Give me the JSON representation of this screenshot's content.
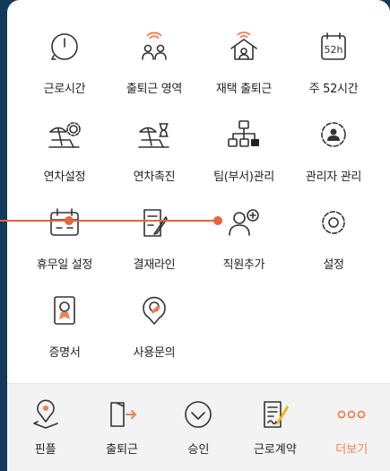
{
  "menu": [
    {
      "label": "근로시간",
      "icon": "clock-icon"
    },
    {
      "label": "출퇴근 영역",
      "icon": "location-area-icon"
    },
    {
      "label": "재택 출퇴근",
      "icon": "home-work-icon"
    },
    {
      "label": "주 52시간",
      "icon": "calendar-52h-icon"
    },
    {
      "label": "연차설정",
      "icon": "beach-gear-icon"
    },
    {
      "label": "연차촉진",
      "icon": "beach-hourglass-icon"
    },
    {
      "label": "팀(부서)관리",
      "icon": "org-chart-icon"
    },
    {
      "label": "관리자 관리",
      "icon": "admin-gear-icon"
    },
    {
      "label": "휴무일 설정",
      "icon": "calendar-holiday-icon"
    },
    {
      "label": "결재라인",
      "icon": "approval-doc-icon"
    },
    {
      "label": "직원추가",
      "icon": "add-user-icon"
    },
    {
      "label": "설정",
      "icon": "gear-icon"
    },
    {
      "label": "증명서",
      "icon": "certificate-icon"
    },
    {
      "label": "사용문의",
      "icon": "inquiry-pin-icon"
    }
  ],
  "calendar_badge": "52h",
  "bottom_nav": [
    {
      "label": "핀플",
      "icon": "pinplus-icon"
    },
    {
      "label": "출퇴근",
      "icon": "door-icon"
    },
    {
      "label": "승인",
      "icon": "approve-check-icon"
    },
    {
      "label": "근로계약",
      "icon": "contract-icon"
    },
    {
      "label": "더보기",
      "icon": "more-icon"
    }
  ],
  "colors": {
    "accent": "#f08050",
    "annotation": "#e8643c",
    "background": "#123a5c"
  }
}
